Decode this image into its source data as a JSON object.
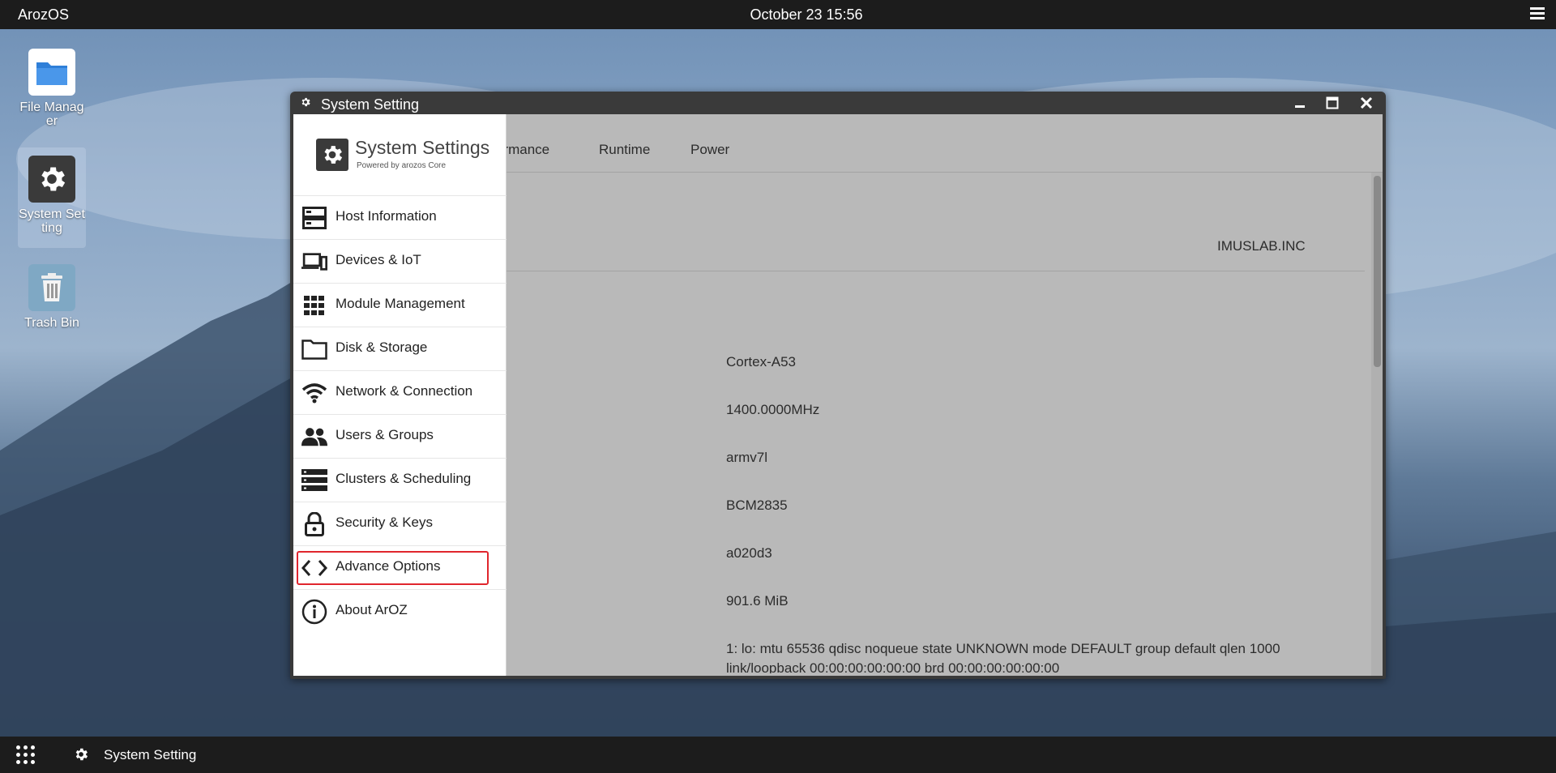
{
  "topbar": {
    "app_name": "ArozOS",
    "clock": "October 23 15:56"
  },
  "desktop": {
    "icons": [
      {
        "label": "File Manag er",
        "icon": "folder-icon"
      },
      {
        "label": "System Set ting",
        "icon": "gear-icon"
      },
      {
        "label": "Trash Bin",
        "icon": "trash-icon"
      }
    ]
  },
  "window": {
    "title": "System Setting",
    "controls": {
      "minimize": "🗕",
      "maximize": "🗖",
      "close": "✕"
    },
    "sidebar": {
      "logo_title": "System Settings",
      "logo_subtitle": "Powered by arozos Core",
      "items": [
        {
          "label": "Host Information",
          "icon": "server-icon"
        },
        {
          "label": "Devices & IoT",
          "icon": "devices-icon"
        },
        {
          "label": "Module Management",
          "icon": "grid-icon"
        },
        {
          "label": "Disk & Storage",
          "icon": "folder-icon"
        },
        {
          "label": "Network & Connection",
          "icon": "wifi-icon"
        },
        {
          "label": "Users & Groups",
          "icon": "users-icon"
        },
        {
          "label": "Clusters & Scheduling",
          "icon": "clusters-icon"
        },
        {
          "label": "Security & Keys",
          "icon": "lock-icon"
        },
        {
          "label": "Advance Options",
          "icon": "code-icon"
        },
        {
          "label": "About ArOZ",
          "icon": "info-icon"
        }
      ]
    },
    "tabs": [
      "ormance",
      "Runtime",
      "Power"
    ],
    "content": {
      "vendor": "IMUSLAB.INC",
      "cpu_model": "Cortex-A53",
      "cpu_freq": "1400.0000MHz",
      "arch": "armv7l",
      "hardware": "BCM2835",
      "revision": "a020d3",
      "memory": "901.6 MiB",
      "net_line1": "1: lo: mtu 65536 qdisc noqueue state UNKNOWN mode DEFAULT group default qlen 1000",
      "net_line2": "link/loopback 00:00:00:00:00:00 brd 00:00:00:00:00:00"
    }
  },
  "taskbar": {
    "task_label": "System Setting"
  },
  "colors": {
    "highlight": "#e0262d",
    "bar": "#1c1c1c"
  }
}
